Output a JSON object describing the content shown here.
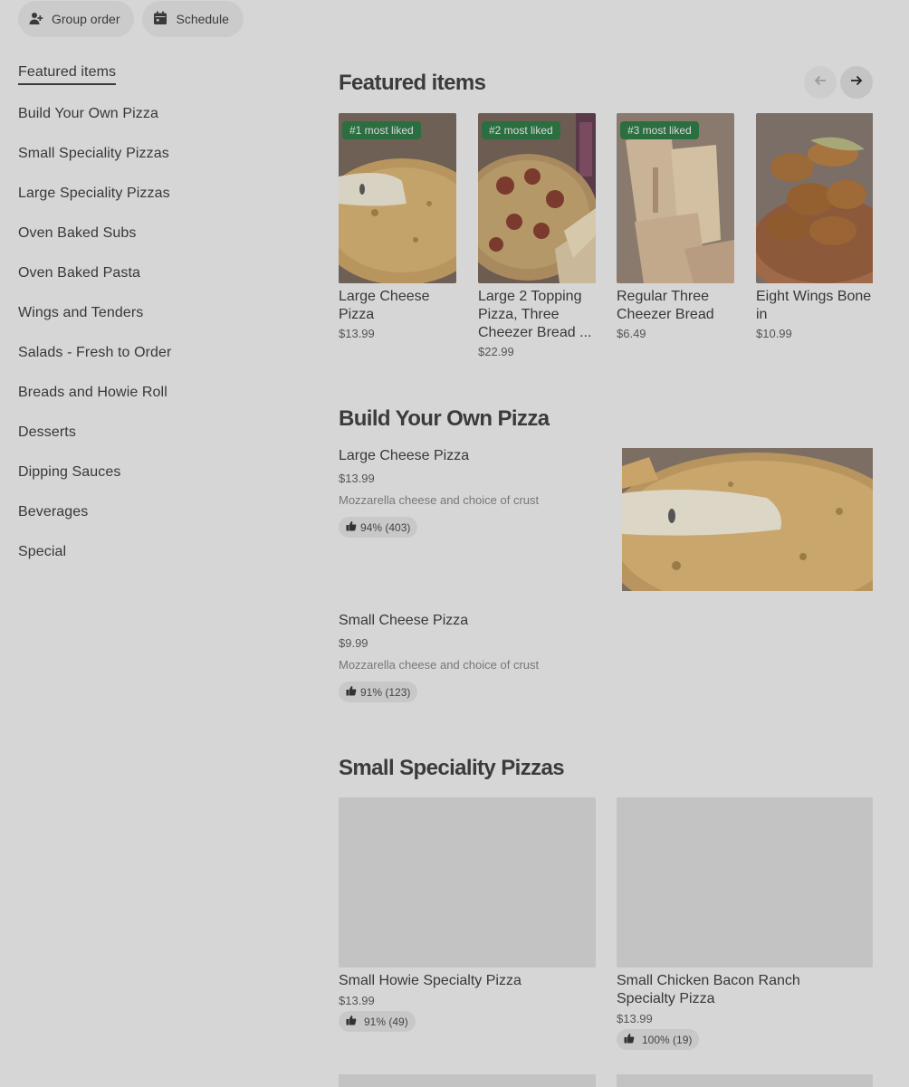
{
  "top": {
    "group_order": "Group order",
    "schedule": "Schedule"
  },
  "sidebar": {
    "items": [
      {
        "label": "Featured items"
      },
      {
        "label": "Build Your Own Pizza"
      },
      {
        "label": "Small Speciality Pizzas"
      },
      {
        "label": "Large Speciality Pizzas"
      },
      {
        "label": "Oven Baked Subs"
      },
      {
        "label": "Oven Baked Pasta"
      },
      {
        "label": "Wings and Tenders"
      },
      {
        "label": "Salads - Fresh to Order"
      },
      {
        "label": "Breads and Howie Roll"
      },
      {
        "label": "Desserts"
      },
      {
        "label": "Dipping Sauces"
      },
      {
        "label": "Beverages"
      },
      {
        "label": "Special"
      }
    ]
  },
  "featured": {
    "title": "Featured items",
    "items": [
      {
        "badge": "#1 most liked",
        "name": "Large Cheese Pizza",
        "price": "$13.99"
      },
      {
        "badge": "#2 most liked",
        "name": "Large 2 Topping Pizza, Three Cheezer Bread ...",
        "price": "$22.99"
      },
      {
        "badge": "#3 most liked",
        "name": "Regular Three Cheezer Bread",
        "price": "$6.49"
      },
      {
        "badge": "",
        "name": "Eight Wings Bone in",
        "price": "$10.99"
      }
    ]
  },
  "build": {
    "title": "Build Your Own Pizza",
    "items": [
      {
        "name": "Large Cheese Pizza",
        "price": "$13.99",
        "desc": "Mozzarella cheese and choice of crust",
        "rating": "94% (403)"
      },
      {
        "name": "Small Cheese Pizza",
        "price": "$9.99",
        "desc": "Mozzarella cheese and choice of crust",
        "rating": "91% (123)"
      }
    ]
  },
  "small_specialty": {
    "title": "Small Speciality Pizzas",
    "items": [
      {
        "name": "Small Howie Specialty Pizza",
        "price": "$13.99",
        "rating": "91% (49)"
      },
      {
        "name": "Small Chicken Bacon Ranch Specialty Pizza",
        "price": "$13.99",
        "rating": "100% (19)"
      }
    ]
  },
  "colors": {
    "overlay_bg": "#d6d6d6",
    "badge_green": "#2b6e40",
    "text": "#383838"
  },
  "icons": [
    "add-person-icon",
    "calendar-icon",
    "arrow-left-icon",
    "arrow-right-icon",
    "thumbs-up-icon"
  ]
}
